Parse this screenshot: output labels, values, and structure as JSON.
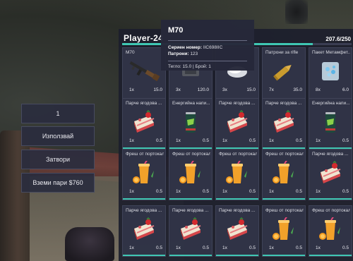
{
  "context_menu": {
    "amount": "1",
    "use_label": "Използвай",
    "close_label": "Затвори",
    "take_money_label": "Вземи пари $760"
  },
  "inventory": {
    "title": "Player-24",
    "weight": "207.6/250",
    "weight_fraction": 0.83,
    "slots": [
      {
        "name": "M70",
        "count": "1x",
        "weight": "15.0",
        "icon": "rifle-icon",
        "bar": false
      },
      {
        "name": "",
        "count": "3x",
        "weight": "120.0",
        "icon": "item-icon",
        "bar": false
      },
      {
        "name": "",
        "count": "3x",
        "weight": "15.0",
        "icon": "bag-icon",
        "bar": false
      },
      {
        "name": "Патрони за rifle",
        "count": "7x",
        "weight": "35.0",
        "icon": "ammo-icon",
        "bar": false
      },
      {
        "name": "Пакет Метамфет...",
        "count": "8x",
        "weight": "6.0",
        "icon": "meth-bag-icon",
        "bar": false
      },
      {
        "name": "Парче ягодова ...",
        "count": "1x",
        "weight": "0.5",
        "icon": "cake-icon",
        "bar": true
      },
      {
        "name": "Енергийна напи...",
        "count": "1x",
        "weight": "0.5",
        "icon": "energy-drink-icon",
        "bar": true
      },
      {
        "name": "Парче ягодова ...",
        "count": "1x",
        "weight": "0.5",
        "icon": "cake-icon",
        "bar": true
      },
      {
        "name": "Парче ягодова ...",
        "count": "1x",
        "weight": "0.5",
        "icon": "cake-icon",
        "bar": true
      },
      {
        "name": "Енергийна напи...",
        "count": "1x",
        "weight": "0.5",
        "icon": "energy-drink-icon",
        "bar": true
      },
      {
        "name": "Фреш от портокал",
        "count": "1x",
        "weight": "0.5",
        "icon": "orange-juice-icon",
        "bar": true
      },
      {
        "name": "Фреш от портокал",
        "count": "1x",
        "weight": "0.5",
        "icon": "orange-juice-icon",
        "bar": true
      },
      {
        "name": "Фреш от портокал",
        "count": "1x",
        "weight": "0.5",
        "icon": "orange-juice-icon",
        "bar": true
      },
      {
        "name": "Фреш от портокал",
        "count": "1x",
        "weight": "0.5",
        "icon": "orange-juice-icon",
        "bar": true
      },
      {
        "name": "Парче ягодова ...",
        "count": "1x",
        "weight": "0.5",
        "icon": "cake-icon",
        "bar": true
      },
      {
        "name": "Парче ягодова ...",
        "count": "1x",
        "weight": "0.5",
        "icon": "cake-icon",
        "bar": true
      },
      {
        "name": "Парче ягодова ...",
        "count": "1x",
        "weight": "0.5",
        "icon": "cake-icon",
        "bar": true
      },
      {
        "name": "Парче ягодова ...",
        "count": "1x",
        "weight": "0.5",
        "icon": "cake-icon",
        "bar": true
      },
      {
        "name": "Фреш от портокал",
        "count": "1x",
        "weight": "0.5",
        "icon": "orange-juice-icon",
        "bar": true
      },
      {
        "name": "Фреш от портокал",
        "count": "1x",
        "weight": "0.5",
        "icon": "orange-juice-icon",
        "bar": true
      }
    ]
  },
  "tooltip": {
    "title": "M70",
    "serial_label": "Сериен номер:",
    "serial_value": "IIC698IIC",
    "ammo_label": "Патрони:",
    "ammo_value": "123",
    "footer": "Тегло: 15.0 | Брой: 1"
  },
  "colors": {
    "accent": "#3fc7b3",
    "panel": "#1c1e2c",
    "slot": "#323548"
  }
}
